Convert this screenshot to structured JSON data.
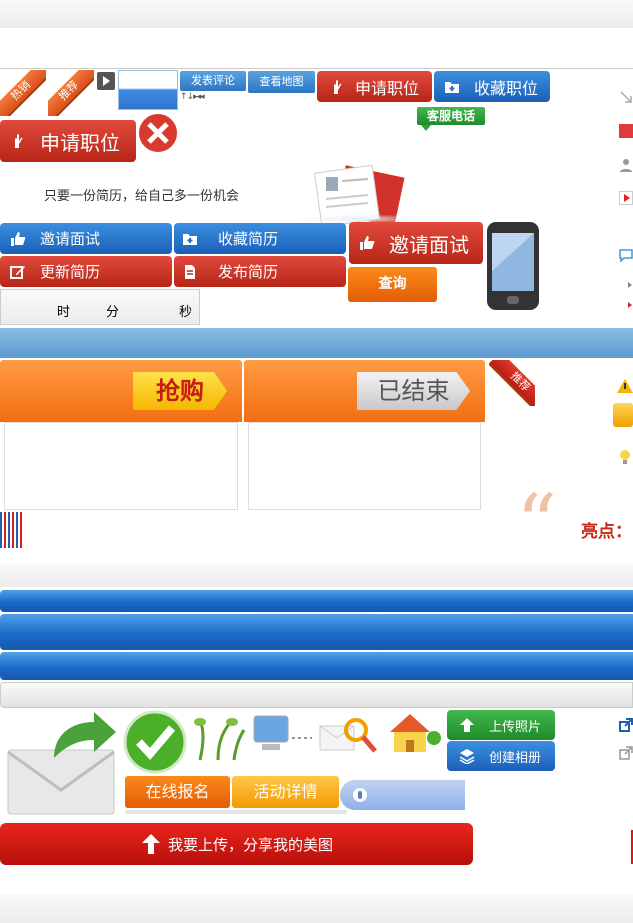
{
  "ribbons": {
    "hot": "热销",
    "recommend": "推荐",
    "recommend2": "推荐"
  },
  "small_buttons": {
    "comment": "发表评论",
    "map": "查看地图",
    "arrows": "↑↓▸◂◂"
  },
  "job": {
    "apply_small": "申请职位",
    "favorite_job": "收藏职位",
    "service_phone": "客服电话",
    "apply_large": "申请职位",
    "slogan": "只要一份简历，给自己多一份机会"
  },
  "resume_buttons": {
    "invite": "邀请面试",
    "favorite_resume": "收藏简历",
    "update": "更新简历",
    "publish": "发布简历",
    "invite_large": "邀请面试",
    "query": "查询"
  },
  "countdown": {
    "hour": "时",
    "minute": "分",
    "second": "秒"
  },
  "deal": {
    "buy": "抢购",
    "ended": "已结束"
  },
  "highlight": {
    "label": "亮点："
  },
  "activity": {
    "signup": "在线报名",
    "details": "活动详情",
    "upload_photo": "上传照片",
    "create_album": "创建相册",
    "share_upload": "我要上传，分享我的美图"
  },
  "colors": {
    "red": "#c62a1c",
    "blue": "#2a72c6",
    "orange": "#f17312",
    "green": "#2f9e3a"
  }
}
